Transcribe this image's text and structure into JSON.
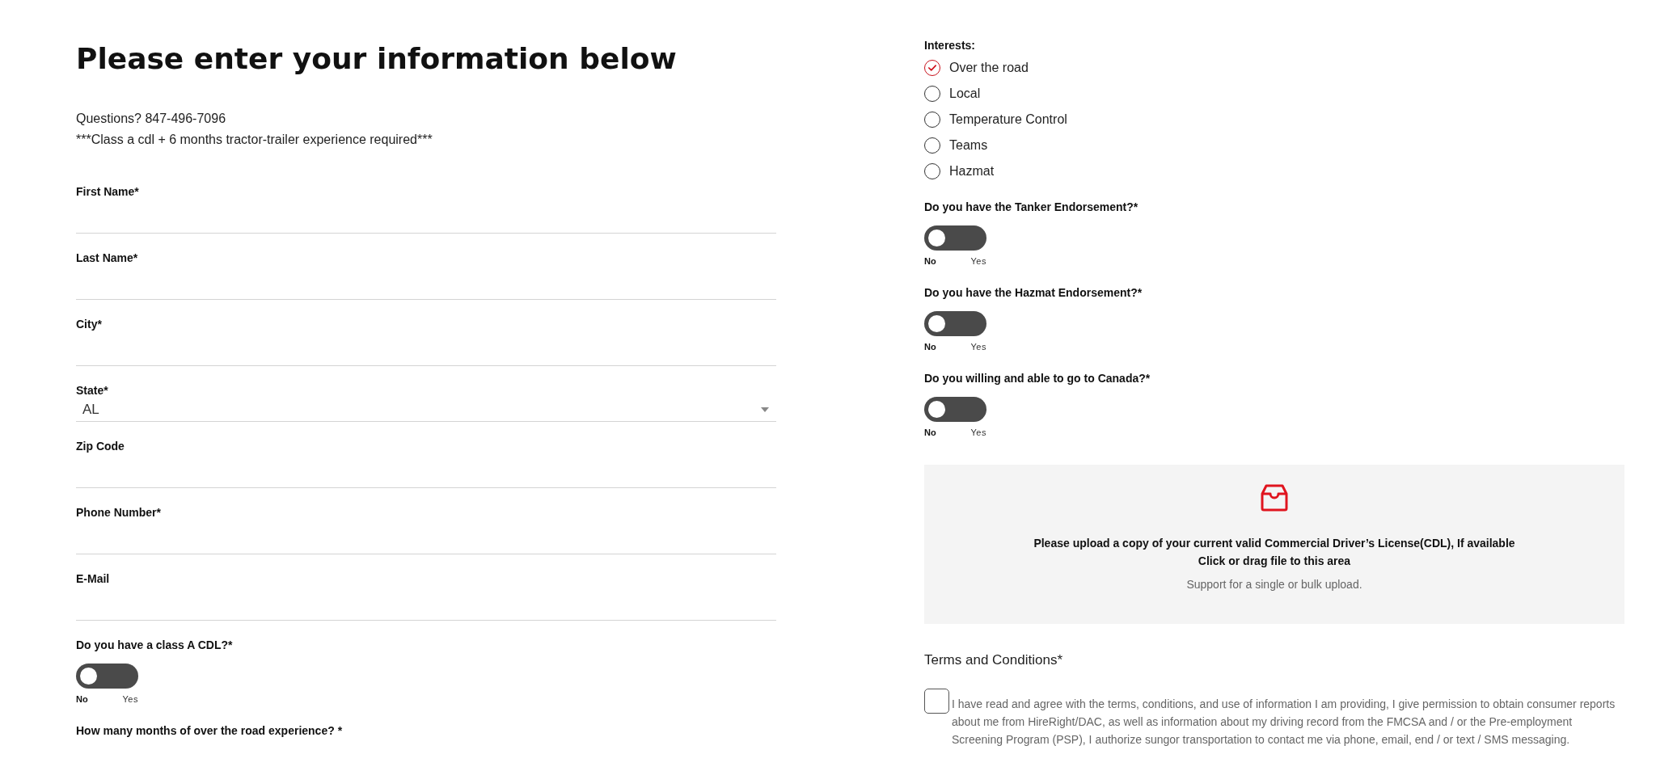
{
  "heading": "Please enter your information below",
  "intro": [
    "Questions? 847-496-7096",
    "***Class a cdl + 6 months tractor-trailer experience required***"
  ],
  "fields": [
    {
      "kind": "text",
      "label": "First Name*"
    },
    {
      "kind": "text",
      "label": "Last Name*"
    },
    {
      "kind": "text",
      "label": "City*"
    },
    {
      "kind": "select",
      "label": "State*",
      "value": "AL"
    },
    {
      "kind": "text",
      "label": "Zip Code"
    },
    {
      "kind": "text",
      "label": "Phone Number*"
    },
    {
      "kind": "text",
      "label": "E-Mail"
    },
    {
      "kind": "toggle",
      "label": "Do you have a class A CDL?*",
      "on": false,
      "off_label": "No",
      "on_label": "Yes"
    },
    {
      "kind": "label",
      "label": "How many months of over the road experience? *"
    }
  ],
  "interests": {
    "label": "Interests:",
    "options": [
      {
        "label": "Over the road",
        "checked": true
      },
      {
        "label": "Local",
        "checked": false
      },
      {
        "label": "Temperature Control",
        "checked": false
      },
      {
        "label": "Teams",
        "checked": false
      },
      {
        "label": "Hazmat",
        "checked": false
      }
    ]
  },
  "questions": [
    {
      "label": "Do you have the Tanker Endorsement?*",
      "on": false,
      "off_label": "No",
      "on_label": "Yes"
    },
    {
      "label": "Do you have the Hazmat Endorsement?*",
      "on": false,
      "off_label": "No",
      "on_label": "Yes"
    },
    {
      "label": "Do you willing and able to go to Canada?*",
      "on": false,
      "off_label": "No",
      "on_label": "Yes"
    }
  ],
  "upload": {
    "title": "Please upload a copy of your current valid Commercial Driver’s License(CDL), If available",
    "action": "Click or drag file to this area",
    "hint": "Support for a single or bulk upload."
  },
  "terms": {
    "title": "Terms and Conditions*",
    "checked": false,
    "text": "I have read and agree with the terms, conditions, and use of information I am providing, I give permission to obtain consumer reports about me from HireRight/DAC, as well as information about my driving record from the FMCSA and / or the Pre-employment Screening Program (PSP), I authorize sungor transportation to contact me via phone, email, end / or text / SMS messaging."
  }
}
